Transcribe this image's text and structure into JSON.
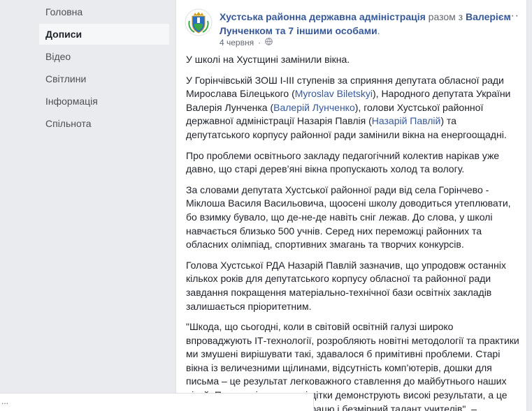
{
  "sidebar": {
    "items": [
      {
        "label": "Головна"
      },
      {
        "label": "Дописи"
      },
      {
        "label": "Відео"
      },
      {
        "label": "Світлини"
      },
      {
        "label": "Інформація"
      },
      {
        "label": "Спільнота"
      }
    ]
  },
  "post": {
    "author": "Хустська районна державна адміністрація",
    "with_text": " разом з",
    "with_people": "Валерієм Лунченком та 7 іншими особами",
    "with_end": ".",
    "date": "4 червня",
    "dot": "·",
    "more": "···",
    "paragraphs": {
      "p1": "У школі на Хустщині замінили вікна.",
      "p2a": "У Горінчівській ЗОШ І-ІІІ ступенів за сприяння депутата обласної ради Мирослава Білецького (",
      "p2_tag1": "Myroslav Biletskyi",
      "p2b": "), Народного депутата України Валерія Лунченка (",
      "p2_tag2": "Валерій Лунченко",
      "p2c": "), голови Хустської районної державної адміністрації Назарія Павлія (",
      "p2_tag3": "Назарій Павлій",
      "p2d": ") та депутатського корпусу районної ради замінили вікна на енергоощадні.",
      "p3": "Про проблеми освітнього закладу педагогічний колектив нарікав уже давно, що старі дерев’яні вікна пропускають холод та вологу.",
      "p4": "За словами депутата Хустської районної ради від села Горінчево - Міклоша Василя Васильовича, щоосені школу доводиться утеплювати, бо взимку бувало, що де-не-де навіть сніг лежав. До слова, у школі навчається близько 500 учнів. Серед них переможці районних та обласних олімпіад, спортивних змагань та творчих конкурсів.",
      "p5": "Голова Хустської РДА Назарій Павлій зазначив, що упродовж останніх кількох років для депутатського корпусу обласної та районної ради завдання покращення матеріально-технічної бази освітніх закладів залишається пріоритетним.",
      "p6": "\"Шкода, що сьогодні, коли в світовій освітній галузі широко впроваджують ІТ-технології, розробляють новітні методології та практики ми змушені вирішувати такі, здавалося б примітивні проблеми. Старі вікна із величезними щілинами, відсутність комп’ютерів, дошки для письма – це результат легковажного ставлення до майбутнього наших дітей. Попри усі складнощі дітки демонструють високі результати, а це свідчить про наполегливу працю і безмірний талант учителів\", –"
    }
  },
  "statusbar": {
    "text": "..."
  },
  "colors": {
    "link": "#365899",
    "page_bg": "#e9ebee",
    "text": "#1d2129",
    "muted": "#616770"
  }
}
